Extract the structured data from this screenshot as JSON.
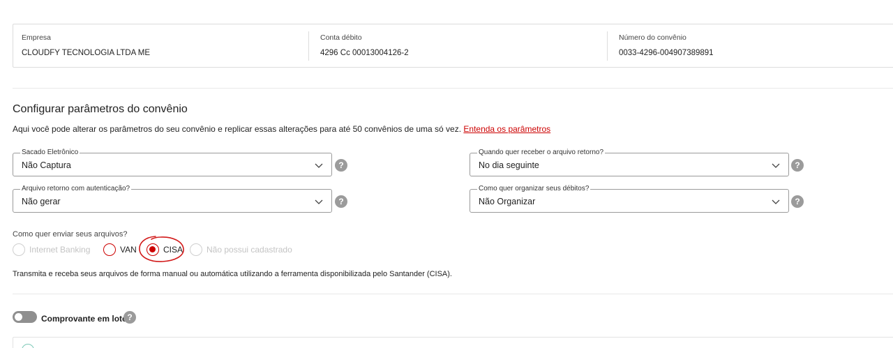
{
  "info": {
    "empresa_label": "Empresa",
    "empresa_value": "CLOUDFY TECNOLOGIA LTDA ME",
    "conta_label": "Conta débito",
    "conta_value": "4296 Cc 00013004126-2",
    "convenio_label": "Número do convênio",
    "convenio_value": "0033-4296-004907389891"
  },
  "section": {
    "title": "Configurar parâmetros do convênio",
    "description": "Aqui você pode alterar os parâmetros do seu convênio e replicar essas alterações para até 50 convênios de uma só vez.",
    "link": "Entenda os parâmetros"
  },
  "fields": {
    "sacado": {
      "label": "Sacado Eletrônico",
      "value": "Não Captura"
    },
    "retorno_quando": {
      "label": "Quando quer receber o arquivo retorno?",
      "value": "No dia seguinte"
    },
    "autenticacao": {
      "label": "Arquivo retorno com autenticação?",
      "value": "Não gerar"
    },
    "organizar": {
      "label": "Como quer organizar seus débitos?",
      "value": "Não Organizar"
    }
  },
  "help_glyph": "?",
  "envio": {
    "question": "Como quer enviar seus arquivos?",
    "options": [
      {
        "label": "Internet Banking",
        "state": "disabled"
      },
      {
        "label": "VAN",
        "state": "enabled"
      },
      {
        "label": "CISA",
        "state": "selected"
      },
      {
        "label": "Não possui cadastrado",
        "state": "disabled"
      }
    ],
    "note": "Transmita e receba seus arquivos de forma manual ou automática utilizando a ferramenta disponibilizada pelo Santander (CISA)."
  },
  "comprovante": {
    "label": "Comprovante em lote",
    "enabled": false
  },
  "colors": {
    "accent": "#cc0000",
    "border": "#9a9a9a",
    "help": "#9b9b9b"
  }
}
